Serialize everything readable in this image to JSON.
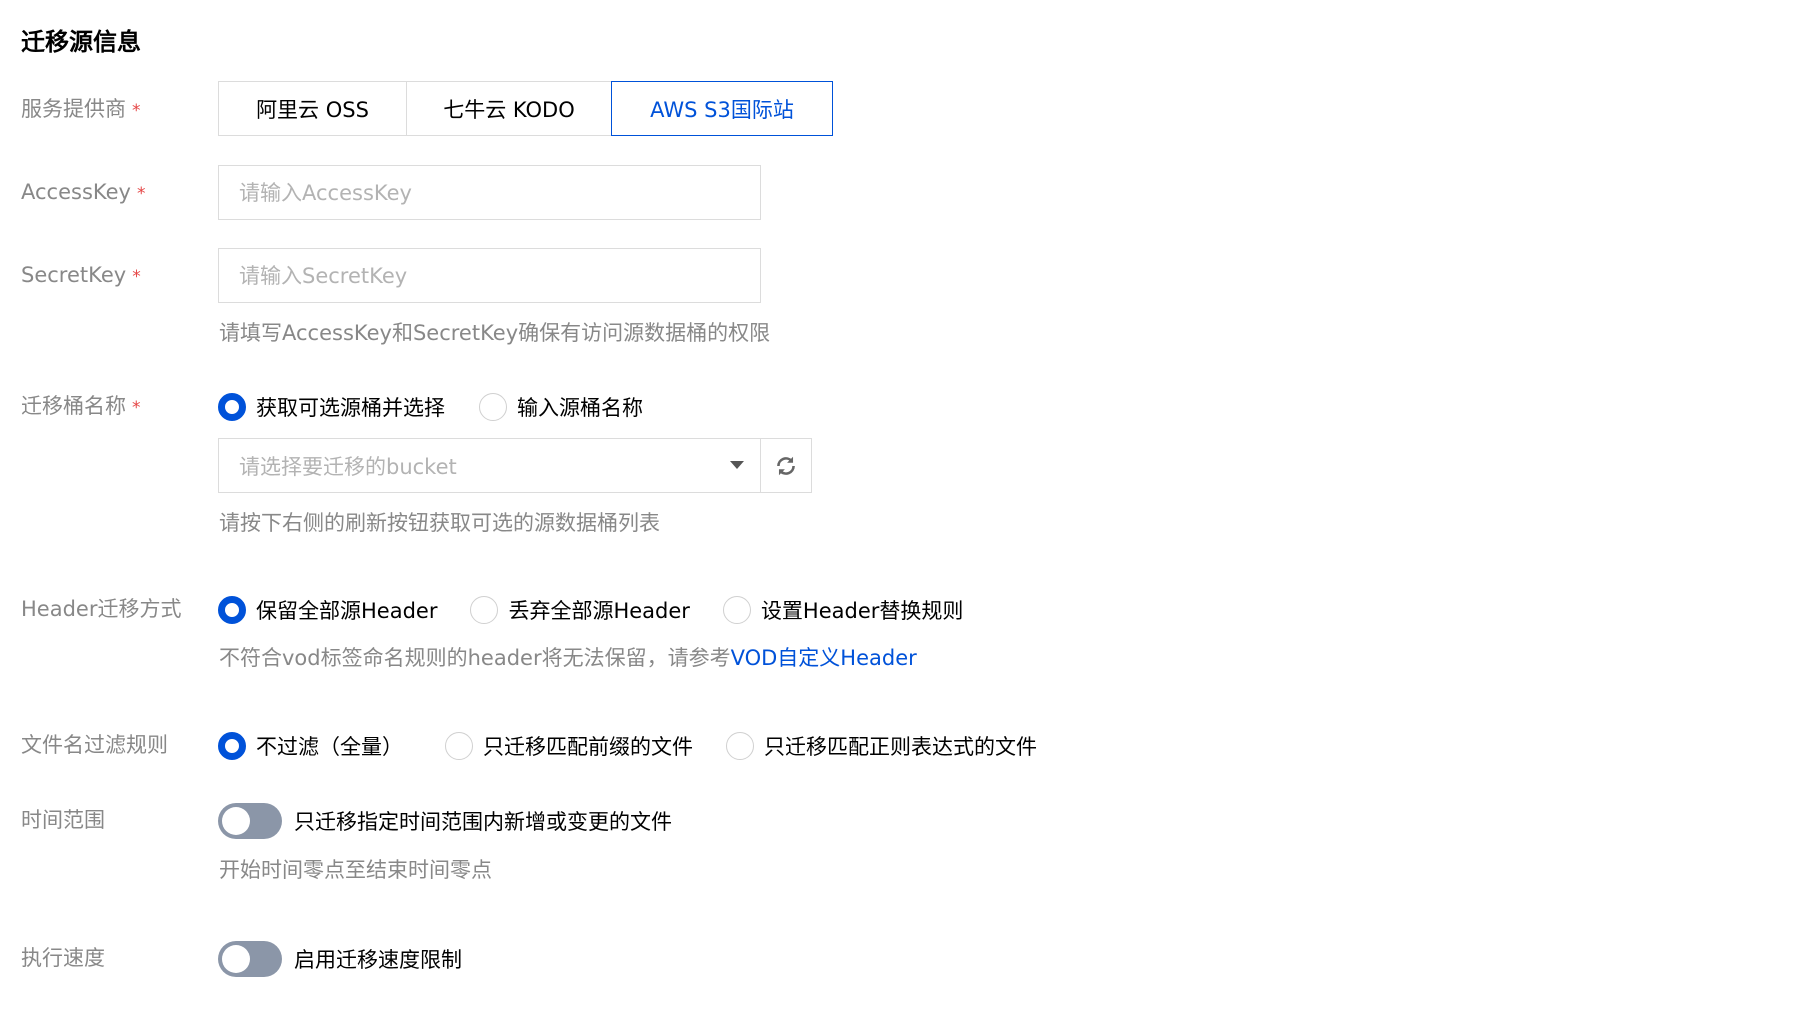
{
  "section": {
    "title": "迁移源信息"
  },
  "provider": {
    "label": "服务提供商",
    "required": "*",
    "options": [
      "阿里云 OSS",
      "七牛云 KODO",
      "AWS S3国际站"
    ],
    "selected": "AWS S3国际站"
  },
  "access_key": {
    "label": "AccessKey",
    "required": "*",
    "placeholder": "请输入AccessKey",
    "value": ""
  },
  "secret_key": {
    "label": "SecretKey",
    "required": "*",
    "placeholder": "请输入SecretKey",
    "value": "",
    "hint": "请填写AccessKey和SecretKey确保有访问源数据桶的权限"
  },
  "bucket": {
    "label": "迁移桶名称",
    "required": "*",
    "options": [
      "获取可选源桶并选择",
      "输入源桶名称"
    ],
    "selected": "获取可选源桶并选择",
    "select_placeholder": "请选择要迁移的bucket",
    "refresh_icon": "refresh-icon",
    "hint": "请按下右侧的刷新按钮获取可选的源数据桶列表"
  },
  "header": {
    "label": "Header迁移方式",
    "options": [
      "保留全部源Header",
      "丢弃全部源Header",
      "设置Header替换规则"
    ],
    "selected": "保留全部源Header",
    "hint_prefix": "不符合vod标签命名规则的header将无法保留，请参考",
    "hint_link": "VOD自定义Header"
  },
  "filename_filter": {
    "label": "文件名过滤规则",
    "options": [
      "不过滤（全量）",
      "只迁移匹配前缀的文件",
      "只迁移匹配正则表达式的文件"
    ],
    "selected": "不过滤（全量）"
  },
  "time_range": {
    "label": "时间范围",
    "toggle_label": "只迁移指定时间范围内新增或变更的文件",
    "enabled": false,
    "hint": "开始时间零点至结束时间零点"
  },
  "speed": {
    "label": "执行速度",
    "toggle_label": "启用迁移速度限制",
    "enabled": false
  },
  "colors": {
    "accent": "#0052d9",
    "required": "#e54545",
    "label": "#888888",
    "toggle_off": "#8b96a8"
  }
}
